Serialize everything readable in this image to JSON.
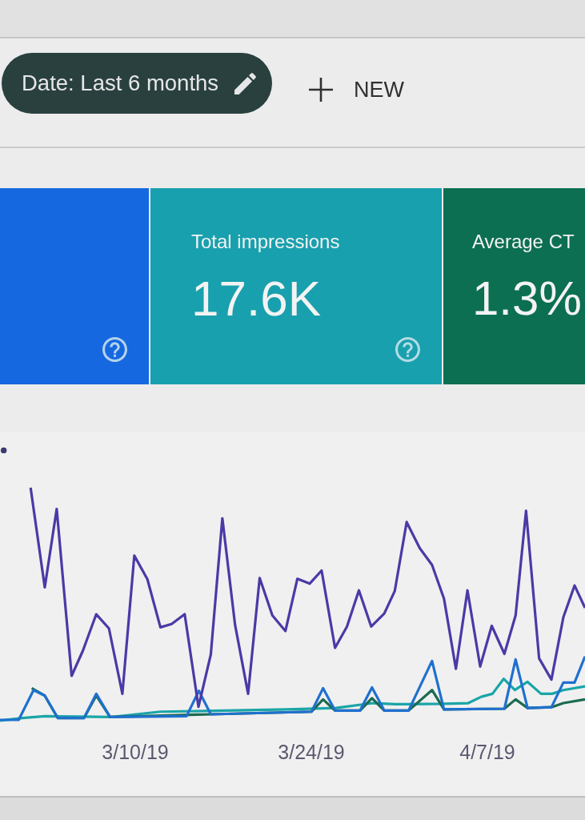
{
  "toolbar": {
    "date_filter": {
      "label": "Date: Last 6 months"
    },
    "new_button": {
      "label": "NEW"
    }
  },
  "metric_cards": [
    {
      "selected": true,
      "color": "#1668e0",
      "has_help": true
    },
    {
      "title": "Total impressions",
      "value": "17.6K",
      "selected": true,
      "color": "#18a0ae",
      "has_help": true
    },
    {
      "title": "Average CT",
      "value": "1.3%",
      "selected": true,
      "color": "#0c6f52",
      "has_help": false
    }
  ],
  "chart": {
    "x_axis_labels": [
      "3/10/19",
      "3/24/19",
      "4/7/19"
    ]
  }
}
